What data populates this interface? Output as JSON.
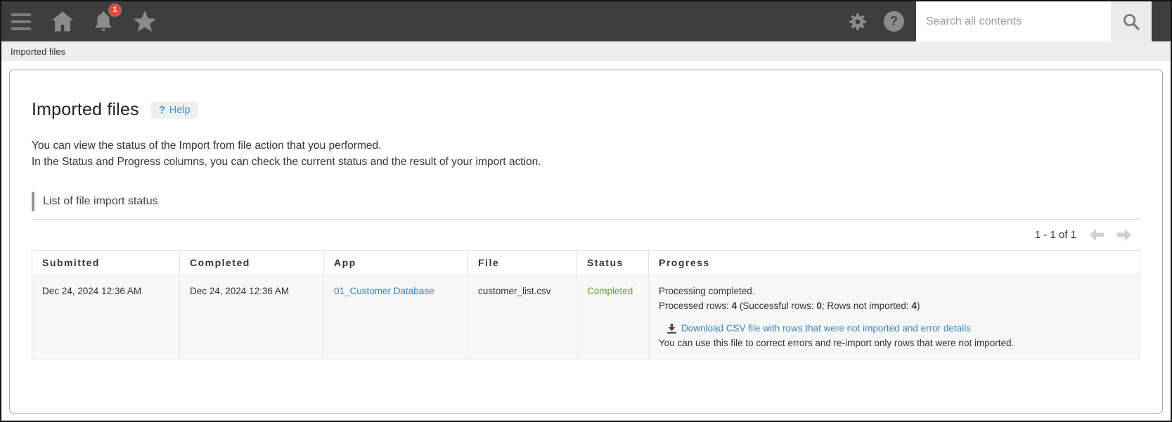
{
  "header": {
    "notification_count": "1",
    "search": {
      "placeholder": "Search all contents"
    }
  },
  "breadcrumb": {
    "current": "Imported files"
  },
  "page": {
    "title": "Imported files",
    "help_icon": "?",
    "help_label": "Help",
    "description_line1": "You can view the status of the Import from file action that you performed.",
    "description_line2": "In the Status and Progress columns, you can check the current status and the result of your import action.",
    "section_title": "List of file import status"
  },
  "pagination": {
    "range_label": "1 - 1 of 1"
  },
  "table": {
    "headers": [
      "Submitted",
      "Completed",
      "App",
      "File",
      "Status",
      "Progress"
    ],
    "row": {
      "submitted": "Dec 24, 2024 12:36 AM",
      "completed": "Dec 24, 2024 12:36 AM",
      "app": "01_Customer Database",
      "file": "customer_list.csv",
      "status": "Completed",
      "progress": {
        "line1": "Processing completed.",
        "processed_prefix": "Processed rows: ",
        "processed_rows": "4",
        "successful_prefix": " (Successful rows: ",
        "successful_rows": "0",
        "not_imported_prefix": "; Rows not imported: ",
        "not_imported_rows": "4",
        "close_paren": ")",
        "download_link": "Download CSV file with rows that were not imported and error details",
        "note": "You can use this file to correct errors and re-import only rows that were not imported."
      }
    }
  },
  "colors": {
    "topbar_bg": "#3e3e3e",
    "icon_gray": "#8b8b8b",
    "badge_red": "#e04b36",
    "link_blue": "#3584bb",
    "status_green": "#64a02c"
  }
}
